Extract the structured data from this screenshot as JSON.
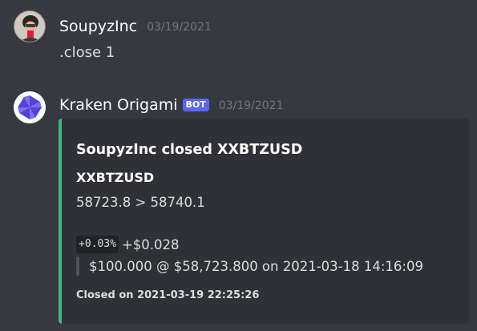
{
  "messages": [
    {
      "author": "SoupyzInc",
      "timestamp": "03/19/2021",
      "text": ".close 1",
      "avatar": "user-photo-avatar"
    },
    {
      "author": "Kraken Origami",
      "bot_tag": "BOT",
      "timestamp": "03/19/2021",
      "avatar": "kraken-origami-logo-avatar",
      "embed": {
        "accent_color": "#43b581",
        "title": "SoupyzInc closed XXBTZUSD",
        "field_name": "XXBTZUSD",
        "field_value": "58723.8 > 58740.1",
        "pnl_percent": "+0.03%",
        "pnl_amount": "+$0.028",
        "position_detail": "$100.000 @ $58,723.800 on 2021-03-18 14:16:09",
        "footer": "Closed on 2021-03-19 22:25:26"
      }
    }
  ],
  "colors": {
    "background": "#36393f",
    "embed_background": "#2f3136",
    "bot_tag": "#5865f2",
    "timestamp": "#72767d"
  }
}
